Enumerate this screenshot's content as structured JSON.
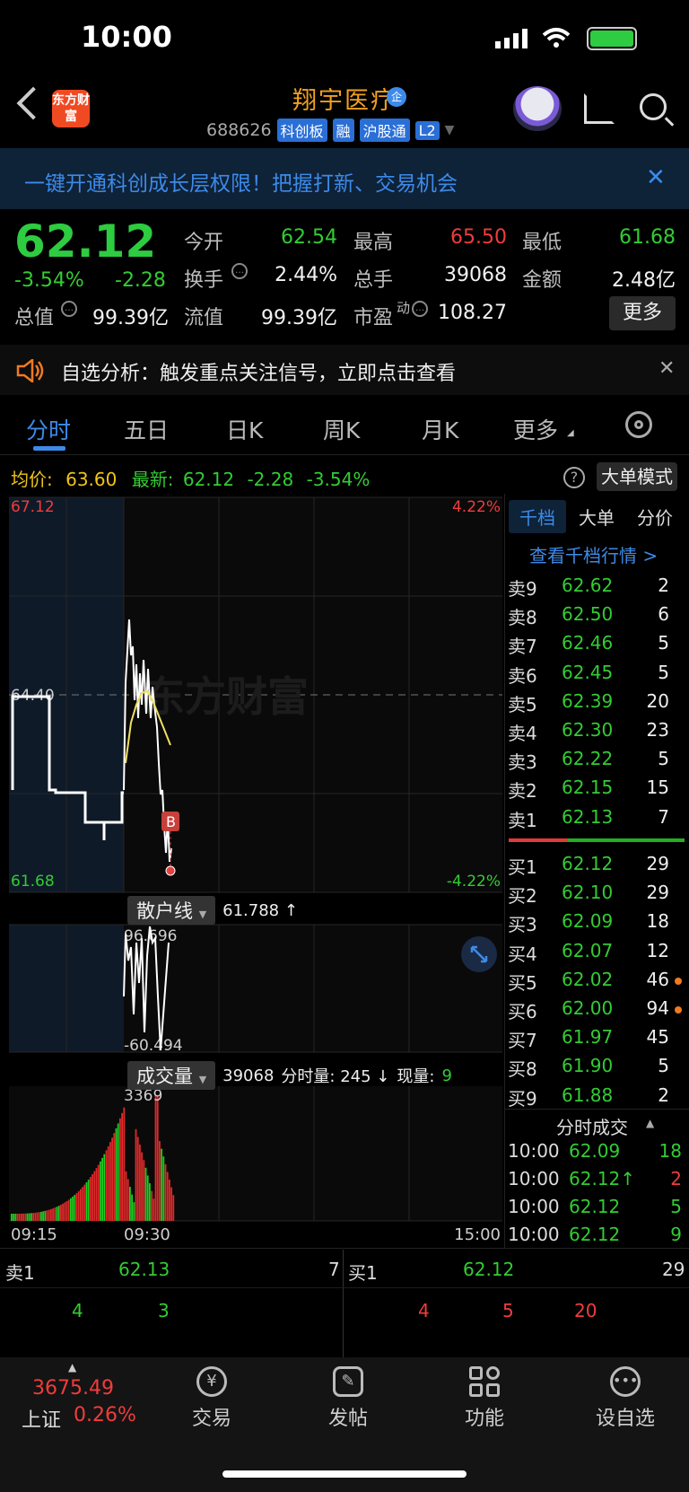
{
  "status_bar": {
    "time": "10:00"
  },
  "header": {
    "logo_text": "东方财富",
    "stock_name": "翔宇医疗",
    "stock_code": "688626",
    "tags": [
      "科创板",
      "融",
      "沪股通",
      "L2"
    ]
  },
  "banner": {
    "text": "一键开通科创成长层权限！把握打新、交易机会"
  },
  "quote": {
    "price": "62.12",
    "change_pct": "-3.54%",
    "change": "-2.28",
    "stats": [
      {
        "label": "今开",
        "value": "62.54",
        "color": "green"
      },
      {
        "label": "最高",
        "value": "65.50",
        "color": "red"
      },
      {
        "label": "最低",
        "value": "61.68",
        "color": "green"
      },
      {
        "label": "换手",
        "value": "2.44%",
        "color": "white"
      },
      {
        "label": "总手",
        "value": "39068",
        "color": "white"
      },
      {
        "label": "金额",
        "value": "2.48亿",
        "color": "white"
      },
      {
        "label": "总值",
        "value": "99.39亿",
        "color": "white"
      },
      {
        "label": "流值",
        "value": "99.39亿",
        "color": "white"
      },
      {
        "label": "市盈",
        "label_sup": "动",
        "value": "108.27",
        "color": "white"
      }
    ],
    "more_button": "更多"
  },
  "notice": {
    "text": "自选分析：触发重点关注信号，立即点击查看"
  },
  "tabs": [
    "分时",
    "五日",
    "日K",
    "周K",
    "月K",
    "更多"
  ],
  "avg_row": {
    "avg_label": "均价:",
    "avg_value": "63.60",
    "latest_label": "最新:",
    "latest_value": "62.12",
    "latest_change": "-2.28",
    "latest_pct": "-3.54%",
    "big_order_mode": "大单模式"
  },
  "chart_data": {
    "type": "line",
    "price_axis": {
      "top": "67.12",
      "mid": "64.40",
      "bottom": "61.68",
      "top_pct": "4.22%",
      "bottom_pct": "-4.22%"
    },
    "time_labels": [
      "09:15",
      "09:30",
      "15:00"
    ],
    "watermark": "东方财富",
    "marker": "B",
    "retail_line": {
      "label": "散户线",
      "value": "61.788 ↑",
      "max": "96.696",
      "min": "-60.494"
    },
    "volume": {
      "label": "成交量",
      "total": "39068",
      "minute_label": "分时量: 245 ↓",
      "now_label": "现量:",
      "now_value": "9",
      "max": "3369"
    }
  },
  "order_book": {
    "tabs": [
      "千档",
      "大单",
      "分价"
    ],
    "link": "查看千档行情 >",
    "asks": [
      {
        "label": "卖9",
        "price": "62.62",
        "vol": "2"
      },
      {
        "label": "卖8",
        "price": "62.50",
        "vol": "6"
      },
      {
        "label": "卖7",
        "price": "62.46",
        "vol": "5"
      },
      {
        "label": "卖6",
        "price": "62.45",
        "vol": "5"
      },
      {
        "label": "卖5",
        "price": "62.39",
        "vol": "20"
      },
      {
        "label": "卖4",
        "price": "62.30",
        "vol": "23"
      },
      {
        "label": "卖3",
        "price": "62.22",
        "vol": "5"
      },
      {
        "label": "卖2",
        "price": "62.15",
        "vol": "15"
      },
      {
        "label": "卖1",
        "price": "62.13",
        "vol": "7"
      }
    ],
    "bids": [
      {
        "label": "买1",
        "price": "62.12",
        "vol": "29"
      },
      {
        "label": "买2",
        "price": "62.10",
        "vol": "29"
      },
      {
        "label": "买3",
        "price": "62.09",
        "vol": "18"
      },
      {
        "label": "买4",
        "price": "62.07",
        "vol": "12"
      },
      {
        "label": "买5",
        "price": "62.02",
        "vol": "46"
      },
      {
        "label": "买6",
        "price": "62.00",
        "vol": "94"
      },
      {
        "label": "买7",
        "price": "61.97",
        "vol": "45"
      },
      {
        "label": "买8",
        "price": "61.90",
        "vol": "5"
      },
      {
        "label": "买9",
        "price": "61.88",
        "vol": "2"
      }
    ],
    "ticks_title": "分时成交",
    "ticks": [
      {
        "time": "10:00",
        "price": "62.09",
        "vol": "18",
        "color": "green"
      },
      {
        "time": "10:00",
        "price": "62.12↑",
        "vol": "2",
        "color": "red"
      },
      {
        "time": "10:00",
        "price": "62.12",
        "vol": "5",
        "color": "green"
      },
      {
        "time": "10:00",
        "price": "62.12",
        "vol": "9",
        "color": "green"
      }
    ]
  },
  "bottom_strip": {
    "sell_label": "卖1",
    "sell_price": "62.13",
    "sell_vol": "7",
    "buy_label": "买1",
    "buy_price": "62.12",
    "buy_vol": "29",
    "left_nums": [
      "4",
      "3"
    ],
    "right_nums": [
      "4",
      "5",
      "20"
    ]
  },
  "nav": {
    "index_value": "3675.49",
    "index_name": "上证",
    "index_pct": "0.26%",
    "items": [
      "交易",
      "发帖",
      "功能",
      "设自选"
    ]
  }
}
